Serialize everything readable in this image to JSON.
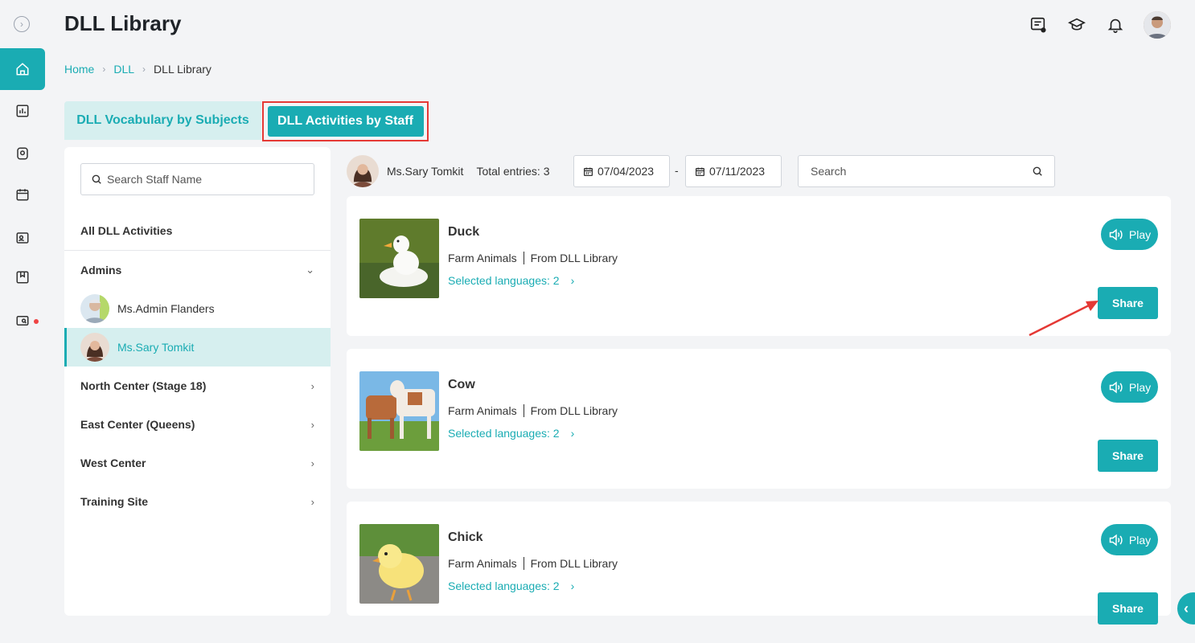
{
  "header": {
    "title": "DLL Library"
  },
  "breadcrumb": {
    "home": "Home",
    "dll": "DLL",
    "current": "DLL Library"
  },
  "tabs": {
    "vocab": "DLL Vocabulary by Subjects",
    "activities": "DLL Activities by Staff"
  },
  "sidebar": {
    "search_placeholder": "Search Staff Name",
    "all_label": "All DLL Activities",
    "groups": [
      {
        "label": "Admins"
      },
      {
        "label": "North Center (Stage 18)"
      },
      {
        "label": "East Center (Queens)"
      },
      {
        "label": "West Center"
      },
      {
        "label": "Training Site"
      }
    ],
    "staff": [
      {
        "name": "Ms.Admin Flanders"
      },
      {
        "name": "Ms.Sary Tomkit"
      }
    ]
  },
  "filter": {
    "staff_name": "Ms.Sary Tomkit",
    "total": "Total entries: 3",
    "date_from": "07/04/2023",
    "date_sep": "-",
    "date_to": "07/11/2023",
    "search_placeholder": "Search"
  },
  "cards": [
    {
      "name": "Duck",
      "category": "Farm Animals",
      "source": "From DLL Library",
      "languages": "Selected languages: 2",
      "play": "Play",
      "share": "Share"
    },
    {
      "name": "Cow",
      "category": "Farm Animals",
      "source": "From DLL Library",
      "languages": "Selected languages: 2",
      "play": "Play",
      "share": "Share"
    },
    {
      "name": "Chick",
      "category": "Farm Animals",
      "source": "From DLL Library",
      "languages": "Selected languages: 2",
      "play": "Play",
      "share": "Share"
    }
  ],
  "colors": {
    "accent": "#1aacb3",
    "highlight": "#e53935"
  }
}
